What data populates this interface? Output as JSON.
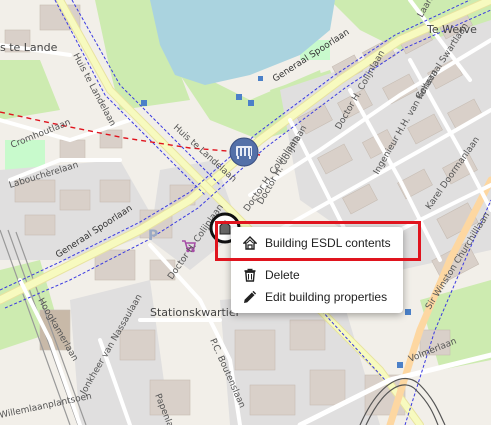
{
  "map": {
    "street_labels": {
      "generaal_spoorlaan_top": "Generaal Spoorlaan",
      "generaal_spoorlaan_left": "Generaal Spoorlaan",
      "huis_te_landelaan_upper": "Huis te Landelaan",
      "huis_te_landelaan_mid": "Huis te Landelaan",
      "cromhoutlaan": "Cromhoutlaan",
      "labouchere": "Labouchèrelaan",
      "colijn_1": "Doctor H. Colijnlaan",
      "colijn_2": "Doctor H. Colijnlaan",
      "colijn_3": "Doctor H. Colijnlaan",
      "colijn_4": "Doctor H. Colijnlaan",
      "ingenieur": "Ingenieur H.H. van Kollaan",
      "swartlaan": "Generaal Swartlaan",
      "karel_doorman": "Karel Doormanlaan",
      "winston": "Sir Winston Churchilllaan",
      "volmerlaan": "Volmerlaan",
      "boutenslaan": "P.C. Boutenslaan",
      "hoogkamerlaan": "Hoogkamerlaan",
      "nassaulaan": "Jonkheer van Nassaulaan",
      "plantsoen": "Willemlaanplantsoen",
      "papenlaan": "Papenlaan",
      "right_top_laan": "Laan"
    },
    "place_labels": {
      "huis_te_lande": "s te Lande",
      "te_werve": "Te Werve",
      "stationskwartier": "Stationskwartier"
    },
    "parking_glyph": "P"
  },
  "context_menu": {
    "items": [
      {
        "label": "Building ESDL contents",
        "icon": "building-icon"
      },
      {
        "label": "Delete",
        "icon": "trash-icon"
      },
      {
        "label": "Edit building properties",
        "icon": "pencil-icon"
      }
    ]
  },
  "colors": {
    "highlight": "#e0141e",
    "water": "#aad3df",
    "park": "#c8facc",
    "building": "#d9d0c9",
    "road_major": "#f7fabf",
    "asset_marker": "#5470a8"
  }
}
